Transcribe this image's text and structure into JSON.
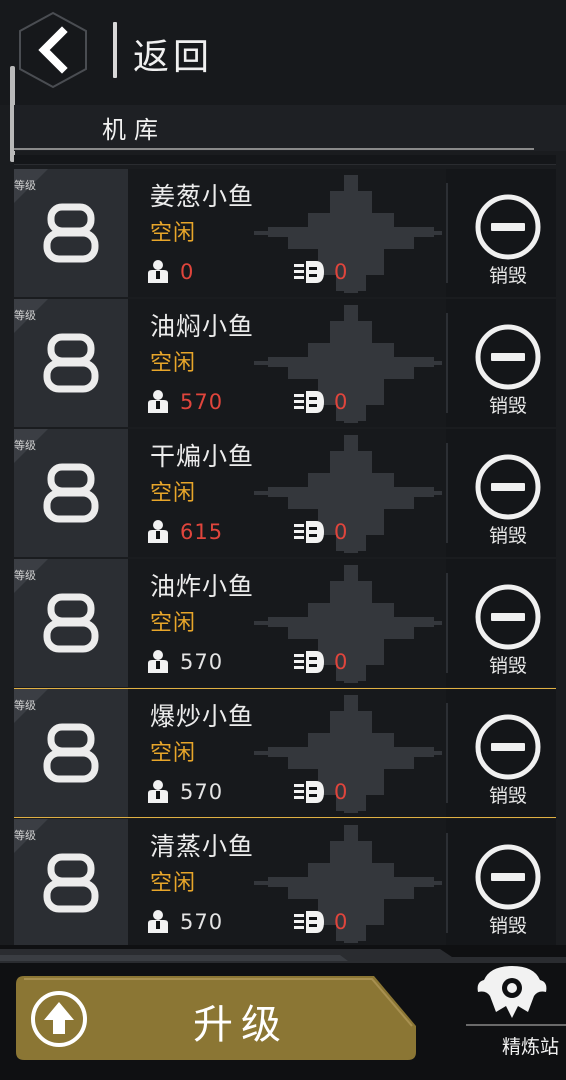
{
  "header": {
    "back_icon": "chevron-left-icon",
    "back_label": "返回",
    "section_title": "机库"
  },
  "colors": {
    "accent_gold": "#e0b043",
    "status_orange": "#e8a62a",
    "value_red": "#e0453c",
    "upgrade_gold": "#8b7634"
  },
  "hangar": {
    "items": [
      {
        "level_tag": "等级",
        "level": "8",
        "name": "姜葱小鱼",
        "status": "空闲",
        "crew": "0",
        "crew_red": true,
        "ammo": "0",
        "action": "销毁",
        "selected": false
      },
      {
        "level_tag": "等级",
        "level": "8",
        "name": "油焖小鱼",
        "status": "空闲",
        "crew": "570",
        "crew_red": true,
        "ammo": "0",
        "action": "销毁",
        "selected": false
      },
      {
        "level_tag": "等级",
        "level": "8",
        "name": "干煸小鱼",
        "status": "空闲",
        "crew": "615",
        "crew_red": true,
        "ammo": "0",
        "action": "销毁",
        "selected": false
      },
      {
        "level_tag": "等级",
        "level": "8",
        "name": "油炸小鱼",
        "status": "空闲",
        "crew": "570",
        "crew_red": false,
        "ammo": "0",
        "action": "销毁",
        "selected": false
      },
      {
        "level_tag": "等级",
        "level": "8",
        "name": "爆炒小鱼",
        "status": "空闲",
        "crew": "570",
        "crew_red": false,
        "ammo": "0",
        "action": "销毁",
        "selected": true
      },
      {
        "level_tag": "等级",
        "level": "8",
        "name": "清蒸小鱼",
        "status": "空闲",
        "crew": "570",
        "crew_red": false,
        "ammo": "0",
        "action": "销毁",
        "selected": false
      }
    ]
  },
  "footer": {
    "upgrade_label": "升级",
    "upgrade_icon": "arrow-up-circle-icon",
    "refinery_label": "精炼站",
    "refinery_icon": "refinery-emblem-icon"
  }
}
